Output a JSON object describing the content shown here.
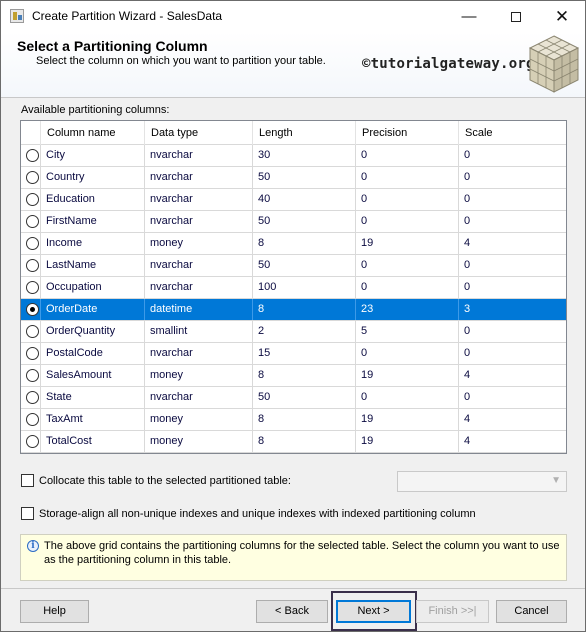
{
  "window": {
    "title": "Create Partition Wizard - SalesData",
    "minimize_glyph": "—",
    "close_glyph": "✕"
  },
  "header": {
    "title": "Select a Partitioning Column",
    "subtitle": "Select the column on which you want to partition your table.",
    "watermark": "©tutorialgateway.org"
  },
  "grid": {
    "label": "Available partitioning columns:",
    "columns": [
      "Column name",
      "Data type",
      "Length",
      "Precision",
      "Scale"
    ],
    "rows": [
      {
        "name": "City",
        "type": "nvarchar",
        "length": "30",
        "precision": "0",
        "scale": "0",
        "selected": false
      },
      {
        "name": "Country",
        "type": "nvarchar",
        "length": "50",
        "precision": "0",
        "scale": "0",
        "selected": false
      },
      {
        "name": "Education",
        "type": "nvarchar",
        "length": "40",
        "precision": "0",
        "scale": "0",
        "selected": false
      },
      {
        "name": "FirstName",
        "type": "nvarchar",
        "length": "50",
        "precision": "0",
        "scale": "0",
        "selected": false
      },
      {
        "name": "Income",
        "type": "money",
        "length": "8",
        "precision": "19",
        "scale": "4",
        "selected": false
      },
      {
        "name": "LastName",
        "type": "nvarchar",
        "length": "50",
        "precision": "0",
        "scale": "0",
        "selected": false
      },
      {
        "name": "Occupation",
        "type": "nvarchar",
        "length": "100",
        "precision": "0",
        "scale": "0",
        "selected": false
      },
      {
        "name": "OrderDate",
        "type": "datetime",
        "length": "8",
        "precision": "23",
        "scale": "3",
        "selected": true
      },
      {
        "name": "OrderQuantity",
        "type": "smallint",
        "length": "2",
        "precision": "5",
        "scale": "0",
        "selected": false
      },
      {
        "name": "PostalCode",
        "type": "nvarchar",
        "length": "15",
        "precision": "0",
        "scale": "0",
        "selected": false
      },
      {
        "name": "SalesAmount",
        "type": "money",
        "length": "8",
        "precision": "19",
        "scale": "4",
        "selected": false
      },
      {
        "name": "State",
        "type": "nvarchar",
        "length": "50",
        "precision": "0",
        "scale": "0",
        "selected": false
      },
      {
        "name": "TaxAmt",
        "type": "money",
        "length": "8",
        "precision": "19",
        "scale": "4",
        "selected": false
      },
      {
        "name": "TotalCost",
        "type": "money",
        "length": "8",
        "precision": "19",
        "scale": "4",
        "selected": false
      }
    ]
  },
  "options": {
    "collocate_label": "Collocate this table to the selected partitioned table:",
    "collocate_checked": false,
    "storage_align_label": "Storage-align all non-unique indexes and unique indexes with indexed partitioning column",
    "storage_align_checked": false
  },
  "info": {
    "text": "The above grid contains the partitioning columns for the selected table. Select the column you want to use as the partitioning column in this table."
  },
  "buttons": {
    "help": "Help",
    "back": "< Back",
    "next": "Next >",
    "finish": "Finish >>|",
    "cancel": "Cancel"
  }
}
